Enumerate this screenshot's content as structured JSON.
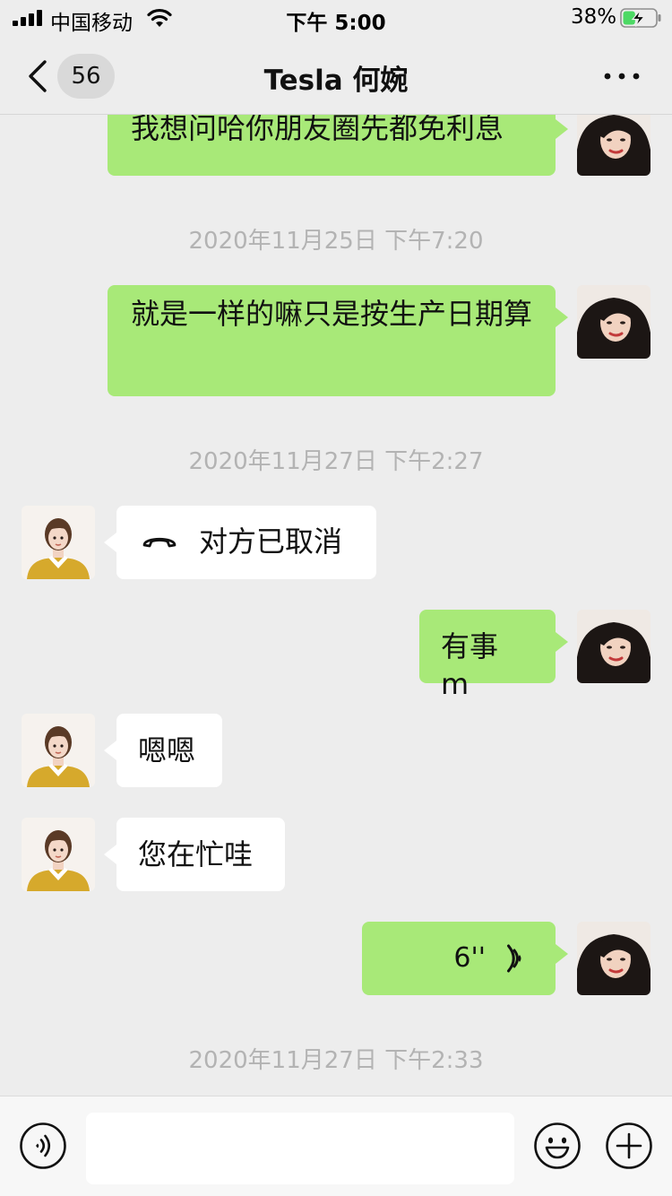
{
  "status_bar": {
    "carrier": "中国移动",
    "time": "下午 5:00",
    "battery_percent": "38%",
    "battery_level": 0.38,
    "battery_charging": true
  },
  "nav": {
    "unread_count": "56",
    "title": "Tesla 何婉"
  },
  "messages": [
    {
      "kind": "text",
      "side": "me",
      "text": "我想问哈你朋友圈先都免利息"
    },
    {
      "kind": "time",
      "text": "2020年11月25日 下午7:20"
    },
    {
      "kind": "text",
      "side": "me",
      "text": "就是一样的嘛只是按生产日期算"
    },
    {
      "kind": "time",
      "text": "2020年11月27日 下午2:27"
    },
    {
      "kind": "call",
      "side": "them",
      "text": "对方已取消"
    },
    {
      "kind": "text",
      "side": "me",
      "text": "有事 m"
    },
    {
      "kind": "text",
      "side": "them",
      "text": "嗯嗯"
    },
    {
      "kind": "text",
      "side": "them",
      "text": "您在忙哇"
    },
    {
      "kind": "voice",
      "side": "me",
      "duration": "6''"
    },
    {
      "kind": "time",
      "text": "2020年11月27日 下午2:33"
    }
  ],
  "input": {
    "value": ""
  },
  "colors": {
    "my_bubble": "#a8e978",
    "their_bubble": "#ffffff",
    "background": "#ededed",
    "timestamp_text": "#b3b3b3",
    "battery_charge": "#4cd964"
  }
}
